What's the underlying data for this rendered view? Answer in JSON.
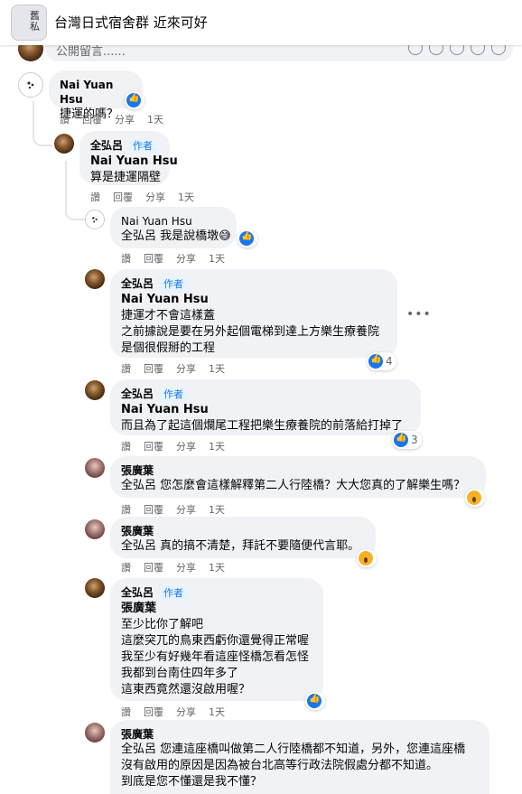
{
  "header": {
    "group_title": "台灣日式宿舍群 近來可好",
    "thumb_text": "舊\n私"
  },
  "composer": {
    "placeholder": "公開留言......"
  },
  "actions": {
    "like": "讚",
    "reply": "回覆",
    "share": "分享"
  },
  "comments": [
    {
      "author": "Nai Yuan Hsu",
      "author_tag": "",
      "lines": [
        "捷運的嗎？"
      ],
      "mention": "",
      "age": "1天",
      "reactions": ""
    },
    {
      "author": "全弘呂",
      "author_tag": "作者",
      "mention": "Nai Yuan Hsu",
      "lines": [
        "算是捷運隔壁"
      ],
      "age": "1天",
      "reactions": ""
    },
    {
      "author": "Nai Yuan Hsu",
      "author_tag": "",
      "mention": "全弘呂",
      "lines": [
        "我是說橋墩😅"
      ],
      "age": "1天",
      "reactions": ""
    },
    {
      "author": "全弘呂",
      "author_tag": "作者",
      "mention": "Nai Yuan Hsu",
      "lines": [
        "捷運才不會這樣蓋",
        "之前據說是要在另外起個電梯到達上方樂生療養院",
        "是個很假掰的工程"
      ],
      "age": "1天",
      "reactions": "4"
    },
    {
      "author": "全弘呂",
      "author_tag": "作者",
      "mention": "Nai Yuan Hsu",
      "lines": [
        "而且為了起這個爛尾工程把樂生療養院的前落給打掉了"
      ],
      "age": "1天",
      "reactions": "3"
    },
    {
      "author": "張廣葉",
      "author_tag": "",
      "mention": "全弘呂",
      "lines": [
        "您怎麼會這樣解釋第二人行陸橋？大大您真的了解樂生嗎？"
      ],
      "age": "1天",
      "reactions": ""
    },
    {
      "author": "張廣葉",
      "author_tag": "",
      "mention": "全弘呂",
      "lines": [
        "真的搞不清楚，拜託不要隨便代言耶。"
      ],
      "age": "1天",
      "reactions": ""
    },
    {
      "author": "全弘呂",
      "author_tag": "作者",
      "mention": "張廣葉",
      "lines": [
        "至少比你了解吧",
        "這麼突兀的鳥東西虧你還覺得正常喔",
        "我至少有好幾年看這座怪橋怎看怎怪",
        "我都到台南住四年多了",
        "這東西竟然還沒啟用喔？"
      ],
      "age": "1天",
      "reactions": ""
    },
    {
      "author": "張廣葉",
      "author_tag": "",
      "mention": "全弘呂",
      "lines": [
        "您連這座橋叫做第二人行陸橋都不知道，另外，您連這座橋",
        "沒有啟用的原因是因為被台北高等行政法院假處分都不知道。",
        "到底是您不懂還是我不懂？"
      ],
      "age": "",
      "reactions": ""
    }
  ]
}
